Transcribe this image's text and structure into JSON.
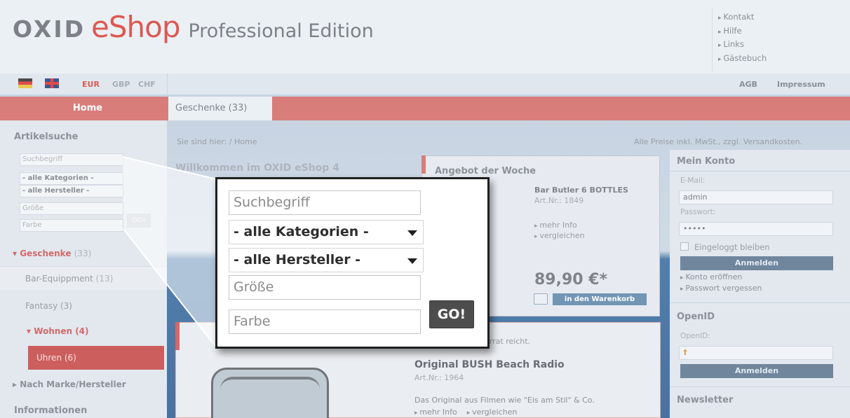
{
  "header": {
    "logo_oxid": "OXID",
    "logo_eshop": "eShop",
    "logo_edition": "Professional Edition",
    "service_links": [
      "Kontakt",
      "Hilfe",
      "Links",
      "Gästebuch"
    ]
  },
  "toolbar": {
    "currencies": [
      "EUR",
      "GBP",
      "CHF"
    ],
    "links": [
      "AGB",
      "Impressum"
    ]
  },
  "nav": {
    "home": "Home",
    "tab": "Geschenke (33)"
  },
  "left": {
    "search_title": "Artikelsuche",
    "search_placeholder": "Suchbegriff",
    "category_select": "- alle Kategorien -",
    "manufacturer_select": "- alle Hersteller -",
    "size_placeholder": "Größe",
    "color_placeholder": "Farbe",
    "go_label": "GO!",
    "categories": [
      {
        "label": "Geschenke",
        "count": "(33)"
      },
      {
        "label": "Bar-Equippment",
        "count": "(13)"
      },
      {
        "label": "Fantasy (3)"
      },
      {
        "label": "Wohnen (4)"
      },
      {
        "label": "Uhren (6)"
      },
      {
        "label": "Nach Marke/Hersteller"
      }
    ],
    "info_title": "Informationen"
  },
  "main": {
    "breadcrumb": "Sie sind hier: / Home",
    "prices_note": "Alle Preise inkl. MwSt., zzgl. Versandkosten.",
    "welcome": "Willkommen im OXID eShop 4",
    "offer": {
      "title": "Angebot der Woche",
      "product_name": "Bar Butler 6 BOTTLES",
      "art_nr": "Art.Nr.: 1849",
      "more_info": "mehr Info",
      "compare": "vergleichen",
      "price": "89,90 €*",
      "cart_button": "in den Warenkorb"
    },
    "second": {
      "stock_note": "orrat reicht.",
      "name": "Original BUSH Beach Radio",
      "art_nr": "Art.Nr.: 1964",
      "desc": "Das Original aus Filmen wie \"Eis am Stil\" & Co.",
      "more_info": "mehr Info",
      "compare": "vergleichen"
    }
  },
  "right": {
    "account_title": "Mein Konto",
    "email_label": "E-Mail:",
    "email_value": "admin",
    "password_label": "Passwort:",
    "password_value": "•••••",
    "remember_label": "Eingeloggt bleiben",
    "login_button": "Anmelden",
    "links": [
      "Konto eröffnen",
      "Passwort vergessen"
    ],
    "openid_title": "OpenID",
    "openid_label": "OpenID:",
    "openid_button": "Anmelden",
    "newsletter_title": "Newsletter"
  },
  "zoom": {
    "search_placeholder": "Suchbegriff",
    "category_select": "- alle Kategorien -",
    "manufacturer_select": "- alle Hersteller -",
    "size_placeholder": "Größe",
    "color_placeholder": "Farbe",
    "go_label": "GO!"
  },
  "colors": {
    "accent_red": "#d36b68",
    "active_category": "#c74848",
    "cart_button": "#5e88aa",
    "login_button": "#5d7690"
  }
}
